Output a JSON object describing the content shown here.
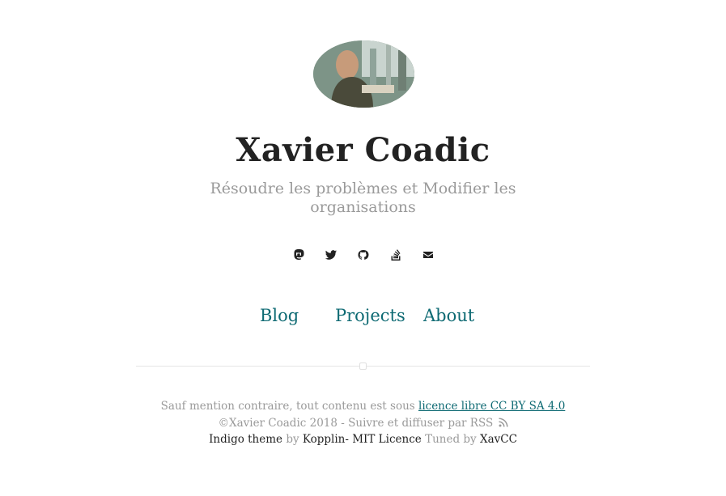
{
  "header": {
    "avatar_alt": "Xavier Coadic",
    "title": "Xavier Coadic",
    "tagline": "Résoudre les problèmes et Modifier les organisations"
  },
  "social": [
    {
      "icon": "mastodon-icon"
    },
    {
      "icon": "twitter-icon"
    },
    {
      "icon": "github-icon"
    },
    {
      "icon": "stackoverflow-icon"
    },
    {
      "icon": "email-icon"
    }
  ],
  "nav": {
    "blog": "Blog",
    "projects": "Projects",
    "about": "About"
  },
  "footer": {
    "prefix": "Sauf mention contraire, tout contenu est sous",
    "licence_link": "licence libre CC BY SA 4.0",
    "copyright": "©Xavier Coadic 2018 - Suivre et diffuser par RSS",
    "theme_name": "Indigo theme",
    "by_1": "by",
    "theme_author": "Kopplin- MIT Licence",
    "tuned_by": "Tuned by",
    "tuner": "XavCC"
  },
  "colors": {
    "link": "#0e6a73",
    "muted": "#9a9a9a",
    "text": "#222222"
  }
}
